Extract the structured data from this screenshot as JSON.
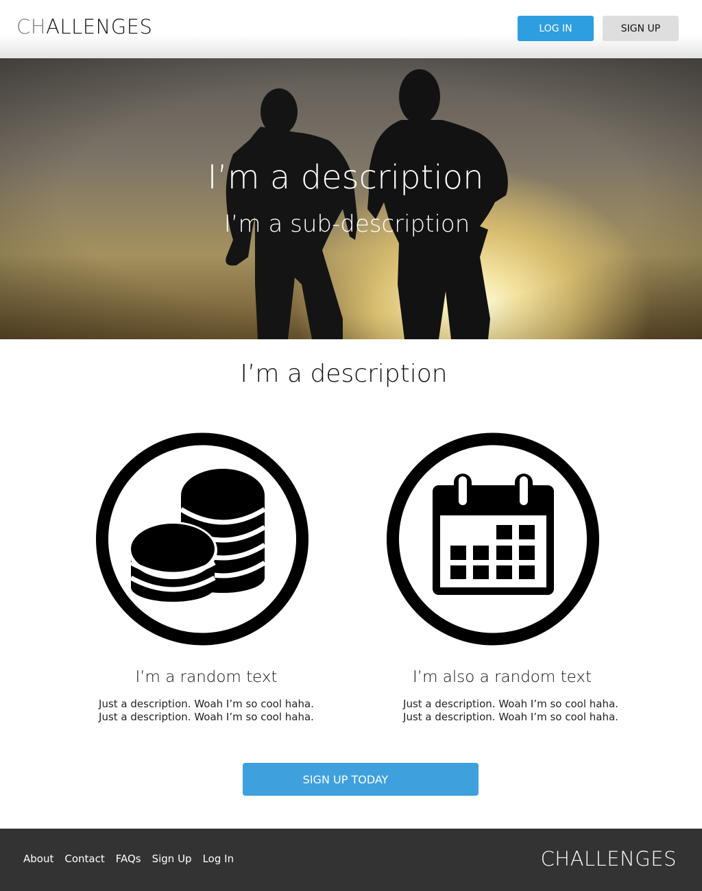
{
  "header": {
    "logo_prefix": "CH",
    "logo_rest": "ALLENGES",
    "login_label": "LOG IN",
    "signup_label": "SIGN UP"
  },
  "hero": {
    "title": "I’m a description",
    "subtitle": "I’m a sub-description"
  },
  "section": {
    "title": "I’m a description"
  },
  "features": [
    {
      "icon": "coins-icon",
      "heading": "I’m a random text",
      "line1": "Just a description. Woah I’m so cool haha.",
      "line2": "Just a description. Woah I’m so cool haha."
    },
    {
      "icon": "calendar-icon",
      "heading": "I’m also a random text",
      "line1": "Just a description. Woah I’m so cool haha.",
      "line2": "Just a description. Woah I’m so cool haha."
    }
  ],
  "cta": {
    "label": "SIGN UP TODAY"
  },
  "footer": {
    "links": [
      "About",
      "Contact",
      "FAQs",
      "Sign Up",
      "Log In"
    ],
    "logo": "CHALLENGES"
  },
  "colors": {
    "accent": "#2d9ee0",
    "cta": "#3fa0de",
    "footer_bg": "#333333",
    "secondary_button": "#dedede"
  }
}
